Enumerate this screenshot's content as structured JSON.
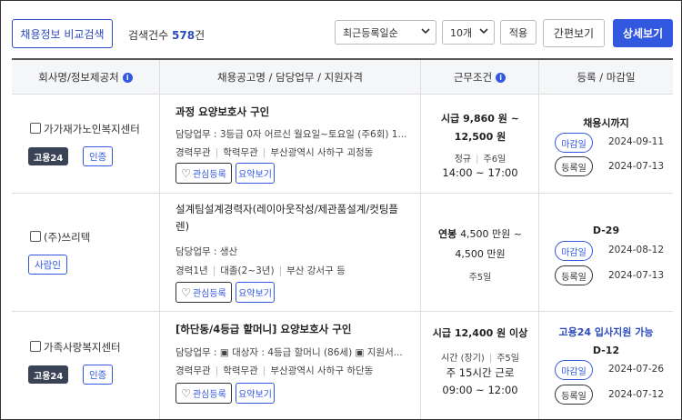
{
  "toolbar": {
    "compare_label": "채용정보 비교검색",
    "count_prefix": "검색건수",
    "count_value": "578",
    "count_suffix": "건",
    "sort_selected": "최근등록일순",
    "per_page_selected": "10개",
    "apply_label": "적용",
    "simple_view_label": "간편보기",
    "detail_view_label": "상세보기"
  },
  "table": {
    "headers": [
      "회사명/정보제공처",
      "채용공고명 / 담당업무 / 지원자격",
      "근무조건",
      "등록 / 마감일"
    ],
    "fav_label": "관심등록",
    "summary_label": "요약보기",
    "deadline_label": "마감일",
    "registered_label": "등록일",
    "rows": [
      {
        "company": "가가재가노인복지센터",
        "tags_dark": [
          "고용24"
        ],
        "tags_line": [
          "인증"
        ],
        "title": "과정 요양보호사 구인",
        "duty": "담당업무 : 3등급 0자 어르신 월요일~토요일 (주6회) 1...",
        "meta": [
          "경력무관",
          "학력무관",
          "부산광역시 사하구 괴정동"
        ],
        "pay_type": "시급",
        "pay_line1": "9,860 원 ~",
        "pay_line2": "12,500 원",
        "employment": "정규",
        "days": "주6일",
        "hours": "14:00 ~ 17:00",
        "deadline_text": "채용시까지",
        "deadline_date": "2024-09-11",
        "registered_date": "2024-07-13"
      },
      {
        "company": "(주)쓰리텍",
        "tags_dark": [],
        "tags_line": [
          "사람인"
        ],
        "title": "설계팀설계경력자(레이아웃작성/제관품설계/컷팅플렌)",
        "duty": "담당업무 : 생산",
        "meta": [
          "경력1년",
          "대졸(2~3년)",
          "부산 강서구 등"
        ],
        "pay_type": "연봉",
        "pay_line1": "4,500 만원 ~",
        "pay_line2": "4,500 만원",
        "days": "주5일",
        "deadline_text": "D-29",
        "deadline_date": "2024-08-12",
        "registered_date": "2024-07-13"
      },
      {
        "company": "가족사랑복지센터",
        "tags_dark": [
          "고용24"
        ],
        "tags_line": [
          "인증"
        ],
        "title": "[하단동/4등급 할머니] 요양보호사 구인",
        "duty": "담당업무 : ▣ 대상자 : 4등급 할머니 (86세) ▣ 지원서...",
        "meta": [
          "경력무관",
          "학력무관",
          "부산광역시 사하구 하단동"
        ],
        "pay_type": "시급",
        "pay_line1": "12,400 원 이상",
        "employment": "시간 (장기)",
        "days": "주5일",
        "weekly_hours": "주 15시간 근로",
        "hours": "09:00 ~ 12:00",
        "support_note": "고용24 입사지원 가능",
        "deadline_text": "D-12",
        "deadline_date": "2024-07-26",
        "registered_date": "2024-07-12"
      }
    ]
  },
  "icons": {
    "info": "info-circle-icon",
    "heart": "heart-outline-icon",
    "chevron": "chevron-down-icon"
  },
  "colors": {
    "accent": "#3358e0",
    "tag_dark": "#3a4256"
  }
}
